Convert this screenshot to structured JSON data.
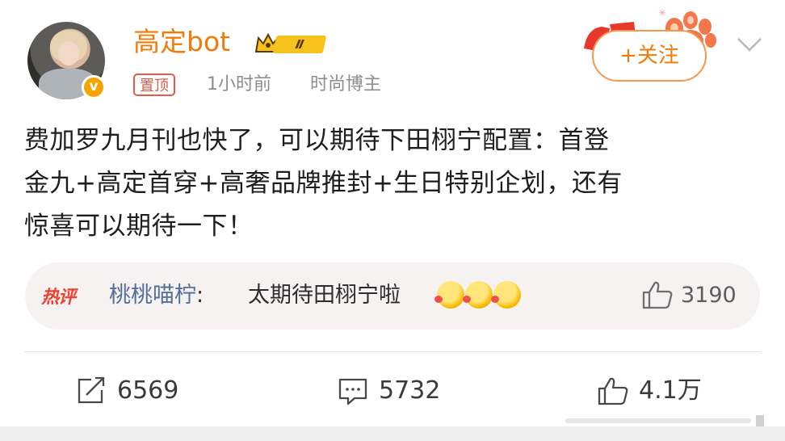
{
  "header": {
    "username": "高定bot",
    "level": "Ⅱ",
    "pin_label": "置顶",
    "time": "1小时前",
    "role": "时尚博主",
    "verified_mark": "v",
    "follow_label": "+关注"
  },
  "post": {
    "text": "费加罗九月刊也快了，可以期待下田栩宁配置：首登\n金九+高定首穿+高奢品牌推封+生日特别企划，还有\n惊喜可以期待一下！"
  },
  "hot_comment": {
    "tag": "热评",
    "commenter": "桃桃喵柠",
    "separator": ":",
    "text": "太期待田栩宁啦",
    "likes": "3190"
  },
  "actions": {
    "repost": "6569",
    "comments": "5732",
    "likes": "4.1万"
  },
  "colors": {
    "brand_orange": "#f27a0a",
    "link_blue": "#536f99",
    "hot_red": "#f0402f"
  },
  "icons": [
    "crown-icon",
    "verified-icon",
    "chevron-down-icon",
    "thumbs-up-icon",
    "repost-icon",
    "comment-icon"
  ]
}
